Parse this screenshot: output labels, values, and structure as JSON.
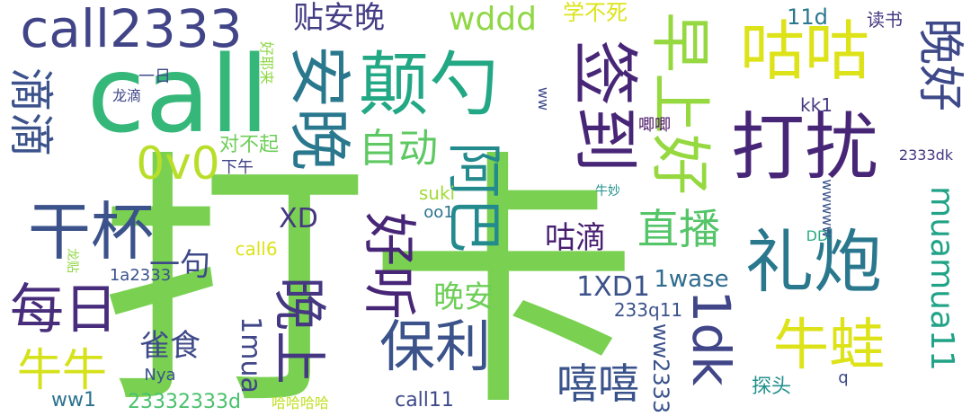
{
  "words": [
    {
      "text": "打卡",
      "color": "#7ad151",
      "orient": "h"
    },
    {
      "text": "call",
      "color": "#35b779",
      "orient": "h"
    },
    {
      "text": "call2333",
      "color": "#414487",
      "orient": "h"
    },
    {
      "text": "颠勺",
      "color": "#22a884",
      "orient": "h"
    },
    {
      "text": "打扰",
      "color": "#482677",
      "orient": "h"
    },
    {
      "text": "咕咕",
      "color": "#dde318",
      "orient": "h"
    },
    {
      "text": "早上好",
      "color": "#95d840",
      "orient": "v"
    },
    {
      "text": "签到",
      "color": "#482677",
      "orient": "v"
    },
    {
      "text": "安晚",
      "color": "#2a788e",
      "orient": "v"
    },
    {
      "text": "贴安晚",
      "color": "#433e85",
      "orient": "h"
    },
    {
      "text": "wddd",
      "color": "#8fd744",
      "orient": "h"
    },
    {
      "text": "学不死",
      "color": "#dde318",
      "orient": "h"
    },
    {
      "text": "11d",
      "color": "#2a788e",
      "orient": "h"
    },
    {
      "text": "读书",
      "color": "#453781",
      "orient": "h"
    },
    {
      "text": "晚好",
      "color": "#3e4989",
      "orient": "v"
    },
    {
      "text": "滴滴",
      "color": "#3b528b",
      "orient": "v"
    },
    {
      "text": "0v0",
      "color": "#b8de29",
      "orient": "h"
    },
    {
      "text": "自动",
      "color": "#5ec962",
      "orient": "h"
    },
    {
      "text": "阿巴",
      "color": "#238a8d",
      "orient": "v"
    },
    {
      "text": "干杯",
      "color": "#3b528b",
      "orient": "h"
    },
    {
      "text": "礼炮",
      "color": "#2a788e",
      "orient": "h"
    },
    {
      "text": "对不起",
      "color": "#6ece58",
      "orient": "h"
    },
    {
      "text": "下午",
      "color": "#414487",
      "orient": "h"
    },
    {
      "text": "XD",
      "color": "#453781",
      "orient": "h"
    },
    {
      "text": "好听",
      "color": "#482677",
      "orient": "v"
    },
    {
      "text": "直播",
      "color": "#54c568",
      "orient": "h"
    },
    {
      "text": "咕滴",
      "color": "#481f70",
      "orient": "h"
    },
    {
      "text": "晚上",
      "color": "#453781",
      "orient": "v"
    },
    {
      "text": "保利",
      "color": "#3b528b",
      "orient": "h"
    },
    {
      "text": "每日",
      "color": "#472d7b",
      "orient": "h"
    },
    {
      "text": "一句",
      "color": "#3e4989",
      "orient": "h"
    },
    {
      "text": "晚安",
      "color": "#6ece58",
      "orient": "h"
    },
    {
      "text": "1dk",
      "color": "#404688",
      "orient": "v"
    },
    {
      "text": "1XD1",
      "color": "#3b528b",
      "orient": "h"
    },
    {
      "text": "1wase",
      "color": "#2f6c8e",
      "orient": "h"
    },
    {
      "text": "牛蛙",
      "color": "#dde318",
      "orient": "h"
    },
    {
      "text": "muamua11",
      "color": "#20a386",
      "orient": "v"
    },
    {
      "text": "嘻嘻",
      "color": "#3a538b",
      "orient": "h"
    },
    {
      "text": "雀食",
      "color": "#3e4989",
      "orient": "h"
    },
    {
      "text": "牛牛",
      "color": "#d5e21a",
      "orient": "h"
    },
    {
      "text": "1mua",
      "color": "#404688",
      "orient": "v"
    },
    {
      "text": "ww2333",
      "color": "#3b528b",
      "orient": "v"
    },
    {
      "text": "23332333d",
      "color": "#4ac16d",
      "orient": "h"
    },
    {
      "text": "Nya",
      "color": "#3b528b",
      "orient": "h"
    },
    {
      "text": "ww1",
      "color": "#2c728e",
      "orient": "h"
    },
    {
      "text": "哈哈哈哈",
      "color": "#c2df23",
      "orient": "h"
    },
    {
      "text": "call11",
      "color": "#3e4989",
      "orient": "h"
    },
    {
      "text": "探头",
      "color": "#21918c",
      "orient": "h"
    },
    {
      "text": "q",
      "color": "#3e4989",
      "orient": "h"
    },
    {
      "text": "suki",
      "color": "#a2da37",
      "orient": "h"
    },
    {
      "text": "oo1",
      "color": "#2c728e",
      "orient": "h"
    },
    {
      "text": "call6",
      "color": "#dde318",
      "orient": "h"
    },
    {
      "text": "1a2333",
      "color": "#3b528b",
      "orient": "h"
    },
    {
      "text": "龙贴",
      "color": "#8fd744",
      "orient": "v"
    },
    {
      "text": "233q11",
      "color": "#3b528b",
      "orient": "h"
    },
    {
      "text": "DD",
      "color": "#27ad81",
      "orient": "h"
    },
    {
      "text": "2333dk",
      "color": "#453781",
      "orient": "h"
    },
    {
      "text": "牛妙",
      "color": "#21918c",
      "orient": "h"
    },
    {
      "text": "wwwww",
      "color": "#3b528b",
      "orient": "v"
    },
    {
      "text": "kk1",
      "color": "#453781",
      "orient": "h"
    },
    {
      "text": "唧唧",
      "color": "#471063",
      "orient": "h"
    },
    {
      "text": "好耶来",
      "color": "#8fd744",
      "orient": "v"
    },
    {
      "text": "ww",
      "color": "#3e4989",
      "orient": "v"
    },
    {
      "text": "一日",
      "color": "#3e4989",
      "orient": "h"
    },
    {
      "text": "龙滴",
      "color": "#404688",
      "orient": "h"
    }
  ]
}
